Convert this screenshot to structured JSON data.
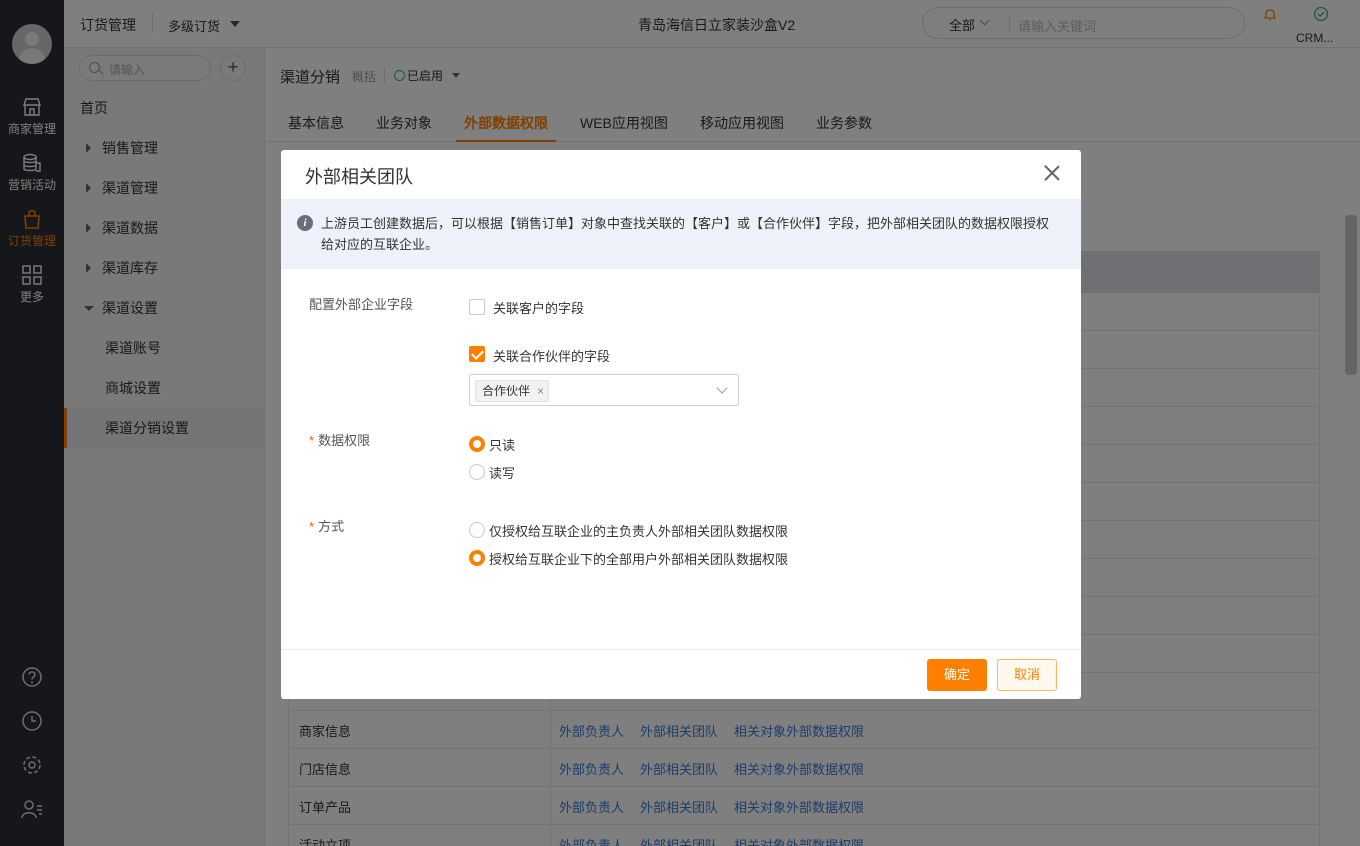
{
  "rail": {
    "items": [
      {
        "label": "商家管理",
        "icon": "store-icon"
      },
      {
        "label": "营销活动",
        "icon": "coins-icon"
      },
      {
        "label": "订货管理",
        "icon": "bag-icon",
        "active": true
      },
      {
        "label": "更多",
        "icon": "grid-icon"
      }
    ],
    "bottom_icons": [
      "help-icon",
      "clock-icon",
      "settings-icon",
      "user-list-icon"
    ]
  },
  "topbar": {
    "app": "订货管理",
    "sub": "多级订货",
    "title": "青岛海信日立家装沙盒V2",
    "search_scope": "全部",
    "search_placeholder": "请输入关键词",
    "crm_label": "CRM..."
  },
  "sidebar": {
    "search_placeholder": "请输入",
    "home": "首页",
    "groups": [
      "销售管理",
      "渠道管理",
      "渠道数据",
      "渠道库存",
      "渠道设置"
    ],
    "children": [
      "渠道账号",
      "商城设置",
      "渠道分销设置"
    ]
  },
  "main": {
    "title": "渠道分销",
    "overview": "概括",
    "status": "已启用",
    "tabs": [
      "基本信息",
      "业务对象",
      "外部数据权限",
      "WEB应用视图",
      "移动应用视图",
      "业务参数"
    ],
    "active_tab": 2,
    "rows": [
      {
        "name": "商家信息",
        "links": [
          "外部负责人",
          "外部相关团队",
          "相关对象外部数据权限"
        ]
      },
      {
        "name": "门店信息",
        "links": [
          "外部负责人",
          "外部相关团队",
          "相关对象外部数据权限"
        ]
      },
      {
        "name": "订单产品",
        "links": [
          "外部负责人",
          "外部相关团队",
          "相关对象外部数据权限"
        ]
      },
      {
        "name": "活动立项",
        "links": [
          "外部负责人",
          "外部相关团队",
          "相关对象外部数据权限"
        ]
      }
    ]
  },
  "modal": {
    "title": "外部相关团队",
    "note": "上游员工创建数据后，可以根据【销售订单】对象中查找关联的【客户】或【合作伙伴】字段，把外部相关团队的数据权限授权给对应的互联企业。",
    "field1_label": "配置外部企业字段",
    "cb1_label": "关联客户的字段",
    "cb1_checked": false,
    "cb2_label": "关联合作伙伴的字段",
    "cb2_checked": true,
    "selected_tag": "合作伙伴",
    "tag_close": "×",
    "field2_label": "数据权限",
    "perm_options": [
      "只读",
      "读写"
    ],
    "perm_selected": 0,
    "field3_label": "方式",
    "mode_options": [
      "仅授权给互联企业的主负责人外部相关团队数据权限",
      "授权给互联企业下的全部用户外部相关团队数据权限"
    ],
    "mode_selected": 1,
    "required_mark": "*",
    "ok": "确定",
    "cancel": "取消"
  },
  "colors": {
    "accent": "#ff8000",
    "link": "#3b7bd4",
    "rail": "#2b2e35"
  }
}
